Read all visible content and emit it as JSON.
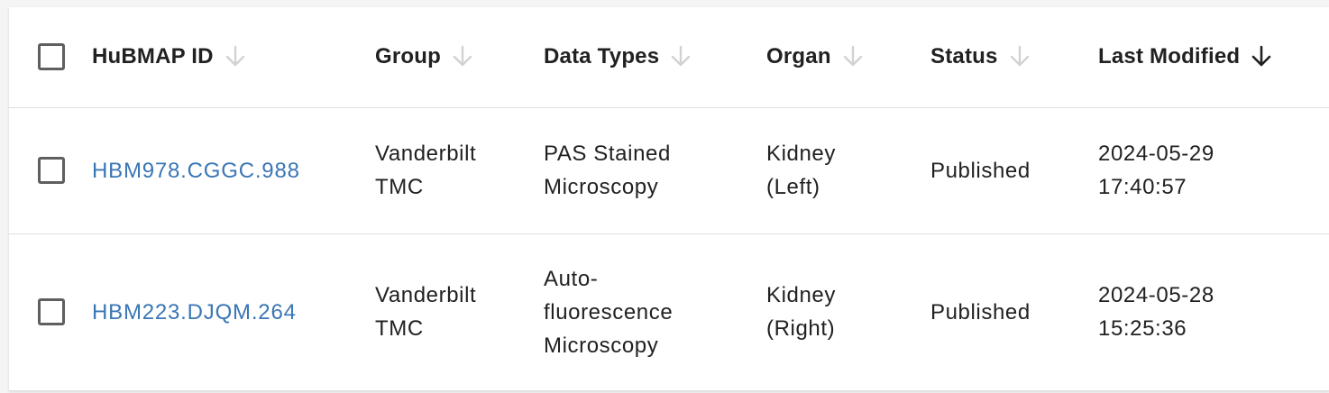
{
  "table": {
    "columns": [
      {
        "label": "HuBMAP ID",
        "sort_icon": "arrow-down-icon",
        "active": false
      },
      {
        "label": "Group",
        "sort_icon": "arrow-down-icon",
        "active": false
      },
      {
        "label": "Data Types",
        "sort_icon": "arrow-down-icon",
        "active": false
      },
      {
        "label": "Organ",
        "sort_icon": "arrow-down-icon",
        "active": false
      },
      {
        "label": "Status",
        "sort_icon": "arrow-down-icon",
        "active": false
      },
      {
        "label": "Last Modified",
        "sort_icon": "arrow-down-icon",
        "active": true
      }
    ],
    "rows": [
      {
        "id": "HBM978.CGGC.988",
        "group_line1": "Vanderbilt",
        "group_line2": "TMC",
        "data_types_line1": "PAS Stained",
        "data_types_line2": "Microscopy",
        "data_types_line3": "",
        "organ_line1": "Kidney",
        "organ_line2": "(Left)",
        "status": "Published",
        "modified_date": "2024-05-29",
        "modified_time": "17:40:57"
      },
      {
        "id": "HBM223.DJQM.264",
        "group_line1": "Vanderbilt",
        "group_line2": "TMC",
        "data_types_line1": "Auto-",
        "data_types_line2": "fluorescence",
        "data_types_line3": "Microscopy",
        "organ_line1": "Kidney",
        "organ_line2": "(Right)",
        "status": "Published",
        "modified_date": "2024-05-28",
        "modified_time": "15:25:36"
      }
    ]
  },
  "colors": {
    "link": "#3a76b5",
    "text": "#212121",
    "sort_inactive": "#d2d2d2",
    "sort_active": "#212121",
    "divider": "#e0e0e0",
    "checkbox_border": "#5f5f5f"
  }
}
